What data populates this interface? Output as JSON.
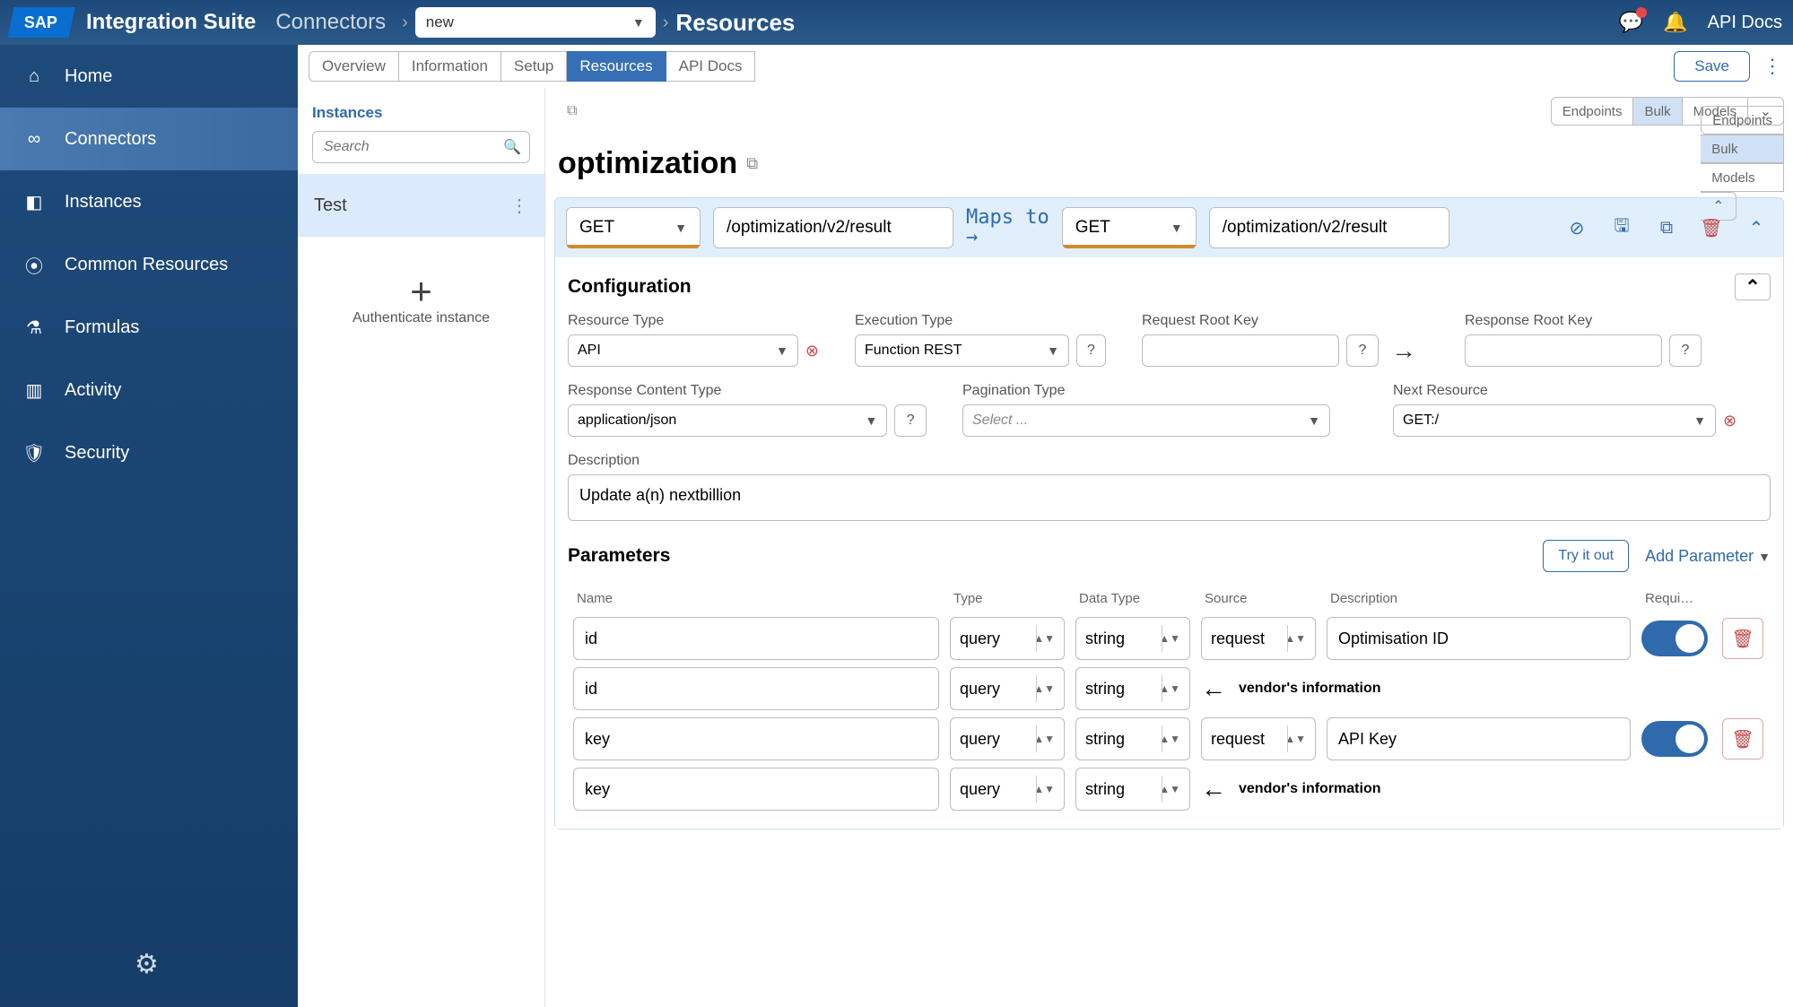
{
  "header": {
    "logo_text": "SAP",
    "suite": "Integration Suite",
    "crumb_connectors": "Connectors",
    "crumb_select_value": "new",
    "crumb_resources": "Resources",
    "api_docs": "API Docs"
  },
  "sidebar": {
    "items": [
      {
        "label": "Home",
        "icon": "home-icon"
      },
      {
        "label": "Connectors",
        "icon": "connectors-icon"
      },
      {
        "label": "Instances",
        "icon": "instances-icon"
      },
      {
        "label": "Common Resources",
        "icon": "common-resources-icon"
      },
      {
        "label": "Formulas",
        "icon": "formulas-icon"
      },
      {
        "label": "Activity",
        "icon": "activity-icon"
      },
      {
        "label": "Security",
        "icon": "security-icon"
      }
    ]
  },
  "tabs": {
    "overview": "Overview",
    "information": "Information",
    "setup": "Setup",
    "resources": "Resources",
    "apidocs": "API Docs",
    "save": "Save"
  },
  "instances": {
    "title": "Instances",
    "search_placeholder": "Search",
    "items": [
      {
        "label": "Test"
      }
    ],
    "add_label": "Authenticate instance"
  },
  "groups": {
    "pills": {
      "endpoints": "Endpoints",
      "bulk": "Bulk",
      "models": "Models"
    },
    "title": "optimization"
  },
  "endpoint": {
    "left_verb": "GET",
    "left_path": "/optimization/v2/result",
    "maps_text": "Maps to →",
    "right_verb": "GET",
    "right_path": "/optimization/v2/result"
  },
  "config": {
    "section_title": "Configuration",
    "resource_type": {
      "label": "Resource Type",
      "value": "API"
    },
    "execution_type": {
      "label": "Execution Type",
      "value": "Function REST"
    },
    "request_root": {
      "label": "Request Root Key",
      "value": ""
    },
    "response_root": {
      "label": "Response Root Key",
      "value": ""
    },
    "response_content": {
      "label": "Response Content Type",
      "value": "application/json"
    },
    "pagination": {
      "label": "Pagination Type",
      "placeholder": "Select ..."
    },
    "next_resource": {
      "label": "Next Resource",
      "value": "GET:/"
    },
    "desc_label": "Description",
    "desc_value": "Update a(n) nextbillion"
  },
  "params": {
    "title": "Parameters",
    "try": "Try it out",
    "add": "Add Parameter",
    "headers": {
      "name": "Name",
      "type": "Type",
      "dtype": "Data Type",
      "source": "Source",
      "desc": "Description",
      "req": "Requi…"
    },
    "vendor_text": "vendor's information",
    "rows": [
      {
        "name": "id",
        "type": "query",
        "dtype": "string",
        "source": "request",
        "desc": "Optimisation ID",
        "required": true
      },
      {
        "name": "key",
        "type": "query",
        "dtype": "string",
        "source": "request",
        "desc": "API Key",
        "required": true
      }
    ],
    "subrows": [
      {
        "name": "id",
        "type": "query",
        "dtype": "string"
      },
      {
        "name": "key",
        "type": "query",
        "dtype": "string"
      }
    ]
  }
}
